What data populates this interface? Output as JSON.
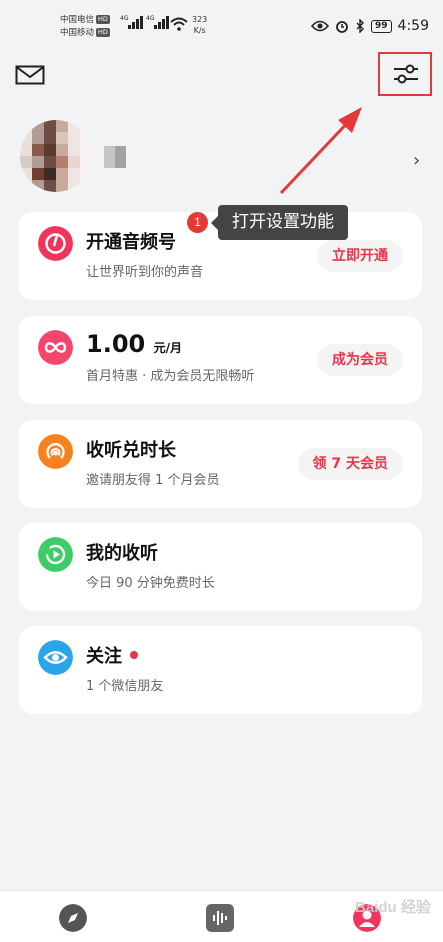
{
  "status_bar": {
    "carrier1": "中国电信",
    "carrier2": "中国移动",
    "hd": "HD",
    "network": "4G",
    "speed_value": "323",
    "speed_unit": "K/s",
    "battery": "99",
    "time": "4:59"
  },
  "annotation": {
    "step": "1",
    "text": "打开设置功能"
  },
  "cards": [
    {
      "title": "开通音频号",
      "subtitle": "让世界听到你的声音",
      "button": "立即开通",
      "color": "#f1345c"
    },
    {
      "title": "1.00",
      "unit": "元/月",
      "subtitle": "首月特惠 · 成为会员无限畅听",
      "button": "成为会员",
      "color": "#f3466a"
    },
    {
      "title": "收听兑时长",
      "subtitle": "邀请朋友得 1 个月会员",
      "button": "领 7 天会员",
      "color": "#f7811d"
    },
    {
      "title": "我的收听",
      "subtitle": "今日 90 分钟免费时长",
      "color": "#3fcb6a"
    },
    {
      "title": "关注",
      "subtitle": "1 个微信朋友",
      "color": "#2aa5e8"
    }
  ],
  "icons": {
    "mail": "mail-icon",
    "settings": "sliders-settings-icon",
    "chevron": "chevron-right-icon",
    "explore": "compass-icon",
    "audio": "waveform-icon",
    "profile": "person-icon"
  },
  "watermark": "Baidu 经验"
}
